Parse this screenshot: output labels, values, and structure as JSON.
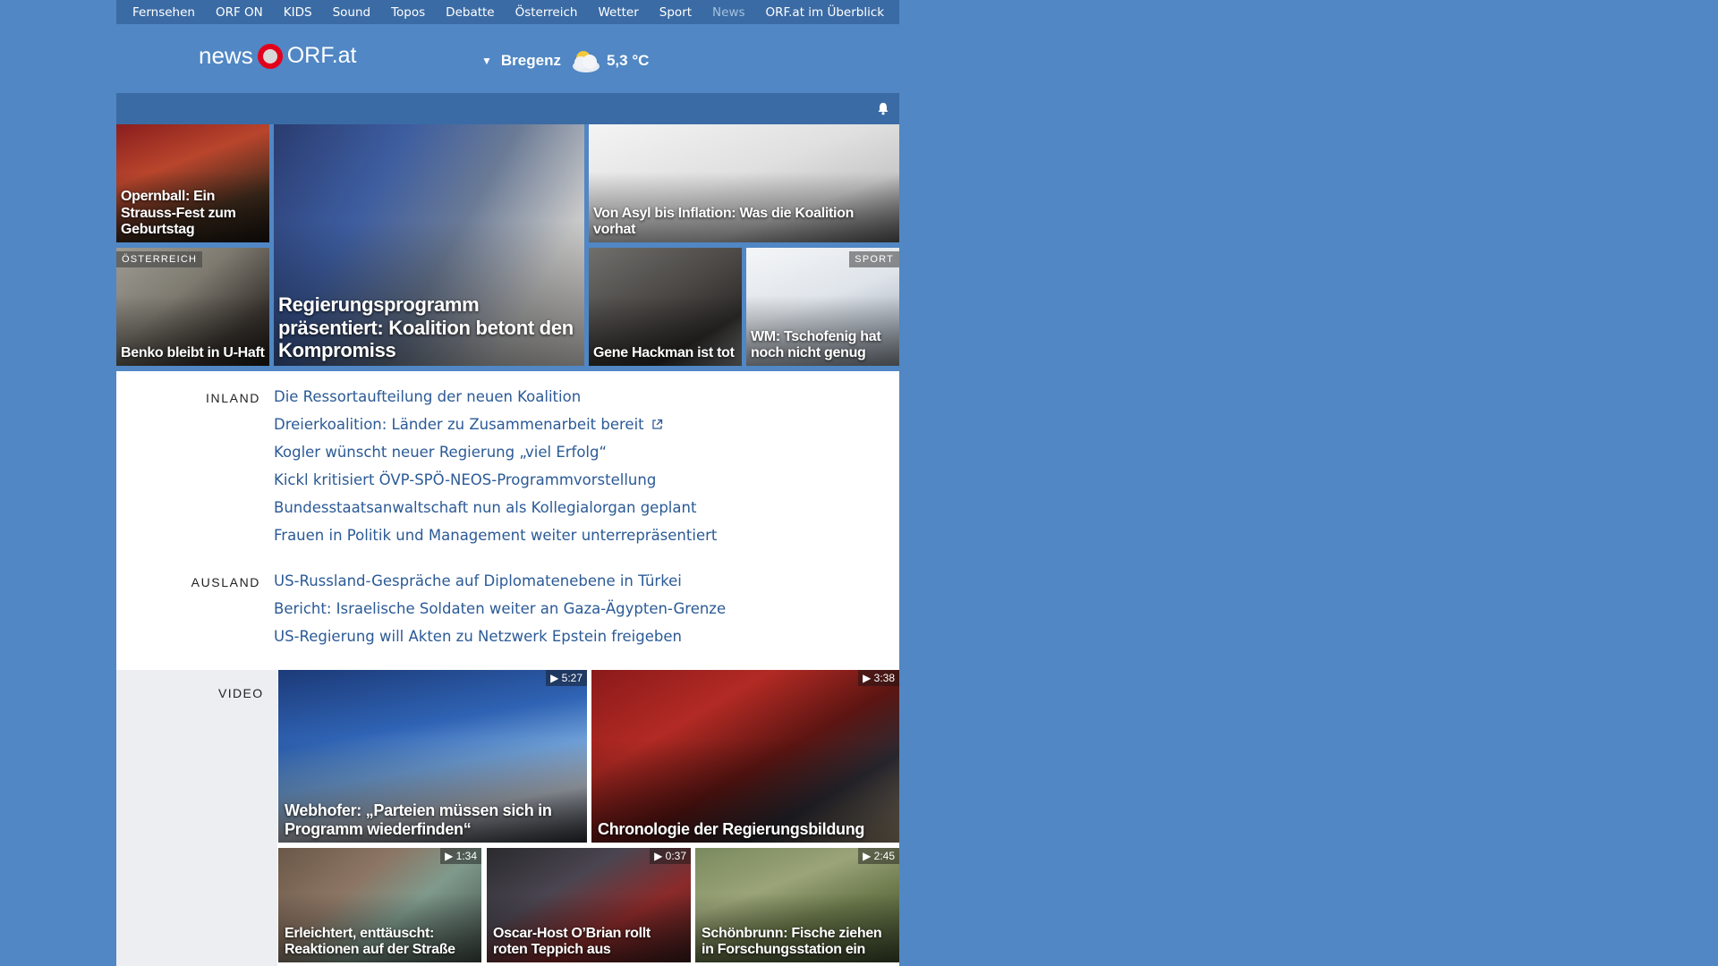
{
  "topnav": {
    "items": [
      "Fernsehen",
      "ORF ON",
      "KIDS",
      "Sound",
      "Topos",
      "Debatte",
      "Österreich",
      "Wetter",
      "Sport",
      "News"
    ],
    "overview": "ORF.at im Überblick"
  },
  "header": {
    "logo_news": "news",
    "logo_orf": "ORF.at",
    "weather_city": "Bregenz",
    "weather_temp": "5,3 °C",
    "weather_icon": "partly-cloudy-icon"
  },
  "tiles": {
    "opernball": "Opernball: Ein Strauss-Fest zum Geburtstag",
    "regierung": "Regierungsprogramm präsentiert: Koalition betont den Kompromiss",
    "asyl": "Von Asyl bis Inflation: Was die Koalition vorhat",
    "benko_tag": "ÖSTERREICH",
    "benko": "Benko bleibt in U-Haft",
    "hackman": "Gene Hackman ist tot",
    "wm_tag": "SPORT",
    "wm": "WM: Tschofenig hat noch nicht genug"
  },
  "inland": {
    "label": "INLAND",
    "headlines": [
      "Die Ressortaufteilung der neuen Koalition",
      "Dreierkoalition: Länder zu Zusammenarbeit bereit",
      "Kogler wünscht neuer Regierung „viel Erfolg“",
      "Kickl kritisiert ÖVP-SPÖ-NEOS-Programmvorstellung",
      "Bundesstaatsanwaltschaft nun als Kollegialorgan geplant",
      "Frauen in Politik und Management weiter unterrepräsentiert"
    ]
  },
  "ausland": {
    "label": "AUSLAND",
    "headlines": [
      "US-Russland-Gespräche auf Diplomatenebene in Türkei",
      "Bericht: Israelische Soldaten weiter an Gaza-Ägypten-Grenze",
      "US-Regierung will Akten zu Netzwerk Epstein freigeben"
    ]
  },
  "video": {
    "label": "VIDEO",
    "items": [
      {
        "title": "Webhofer: „Parteien müssen sich in Programm wiederfinden“",
        "duration": "5:27"
      },
      {
        "title": "Chronologie der Regierungsbildung",
        "duration": "3:38"
      },
      {
        "title": "Erleichtert, enttäuscht: Reaktionen auf der Straße",
        "duration": "1:34"
      },
      {
        "title": "Oscar-Host O’Brian rollt roten Teppich aus",
        "duration": "0:37"
      },
      {
        "title": "Schönbrunn: Fische ziehen in Forschungsstation ein",
        "duration": "2:45"
      }
    ]
  },
  "colors": {
    "background": "#5087c4",
    "nav_bar": "#3b6ba4",
    "link": "#2b5a96",
    "logo_red": "#e3001b"
  }
}
